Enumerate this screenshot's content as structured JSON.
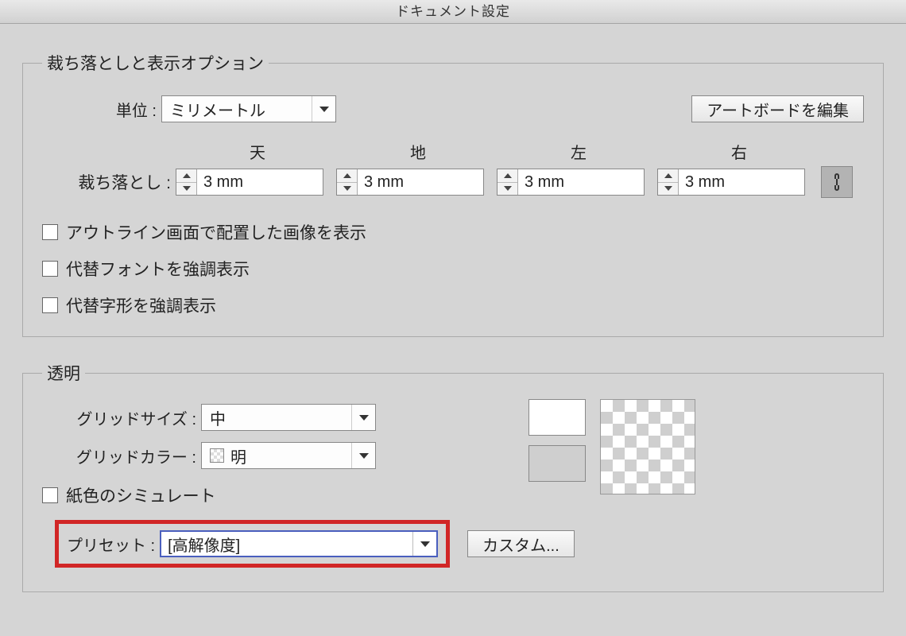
{
  "title": "ドキュメント設定",
  "group1": {
    "legend": "裁ち落としと表示オプション",
    "unit_label": "単位 :",
    "unit_value": "ミリメートル",
    "edit_artboard": "アートボードを編集",
    "head_top": "天",
    "head_bottom": "地",
    "head_left": "左",
    "head_right": "右",
    "bleed_label": "裁ち落とし :",
    "bleed_top": "3 mm",
    "bleed_bottom": "3 mm",
    "bleed_left": "3 mm",
    "bleed_right": "3 mm",
    "cb1": "アウトライン画面で配置した画像を表示",
    "cb2": "代替フォントを強調表示",
    "cb3": "代替字形を強調表示"
  },
  "group2": {
    "legend": "透明",
    "grid_size_label": "グリッドサイズ :",
    "grid_size_value": "中",
    "grid_color_label": "グリッドカラー :",
    "grid_color_value": "明",
    "simulate_paper": "紙色のシミュレート",
    "preset_label": "プリセット :",
    "preset_value": "[高解像度]",
    "custom_btn": "カスタム..."
  }
}
